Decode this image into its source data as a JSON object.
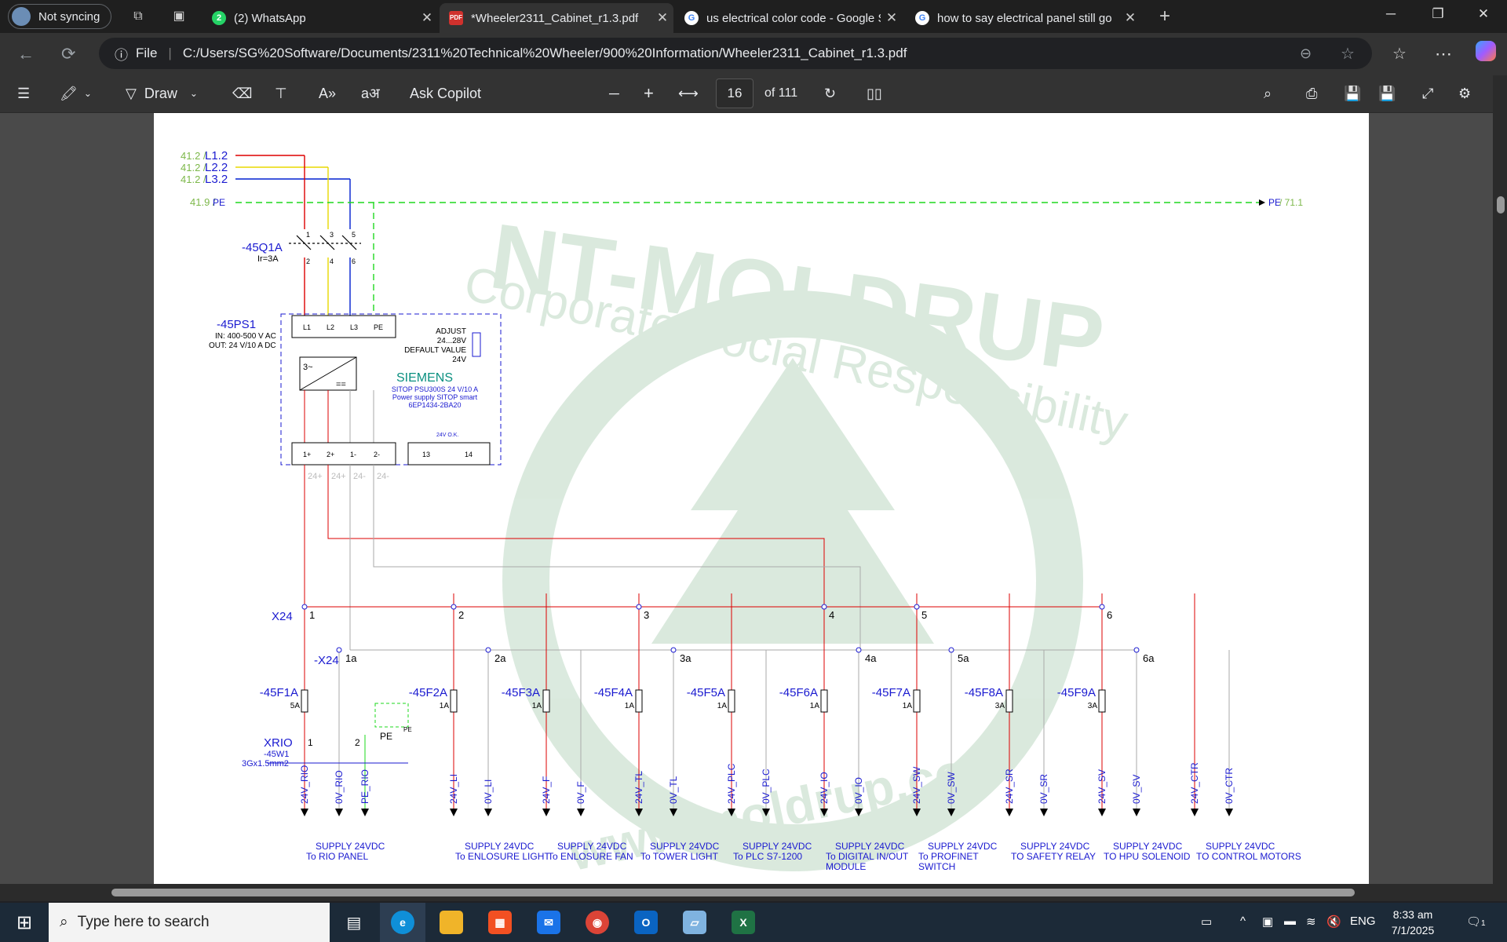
{
  "browser": {
    "profile_label": "Not syncing",
    "tabs": [
      {
        "title": "(2) WhatsApp",
        "badge": "2"
      },
      {
        "title": "*Wheeler2311_Cabinet_r1.3.pdf"
      },
      {
        "title": "us electrical color code - Google S"
      },
      {
        "title": "how to say electrical panel still go"
      }
    ],
    "address": {
      "scheme": "File",
      "url": "C:/Users/SG%20Software/Documents/2311%20Technical%20Wheeler/900%20Information/Wheeler2311_Cabinet_r1.3.pdf"
    }
  },
  "pdf_toolbar": {
    "draw_label": "Draw",
    "copilot_label": "Ask Copilot",
    "read_aloud_icon": "A»",
    "translate_icon": "aअ",
    "page_current": "16",
    "page_total": "of 111"
  },
  "taskbar": {
    "search_placeholder": "Type here to search",
    "time": "8:33 am",
    "date": "7/1/2025",
    "language": "ENG",
    "notification_count": "1"
  },
  "schematic": {
    "watermark_brand": "NT-MOLDRUP",
    "watermark_slogan": "Corporate Social Responsibility",
    "watermark_url": "www.moldrup.com",
    "inputs": [
      {
        "ref": "41.2 /",
        "label": "L1.2"
      },
      {
        "ref": "41.2 /",
        "label": "L2.2"
      },
      {
        "ref": "41.2 /",
        "label": "L3.2"
      },
      {
        "ref": "41.9 /",
        "label": "PE"
      }
    ],
    "pe_out": "PE",
    "pe_out_ref": "/ 71.1",
    "breaker": {
      "tag": "-45Q1A",
      "rating": "Ir=3A",
      "poles": [
        "1",
        "3",
        "5",
        "2",
        "4",
        "6"
      ]
    },
    "psu": {
      "tag": "-45PS1",
      "in": "IN: 400-500 V AC",
      "out": "OUT: 24 V/10 A DC",
      "adjust": [
        "ADJUST",
        "24...28V",
        "DEFAULT VALUE",
        "24V"
      ],
      "brand": "SIEMENS",
      "desc": [
        "SITOP PSU300S 24 V/10 A",
        "Power supply SITOP smart",
        "6EP1434-2BA20"
      ],
      "in_terms": [
        "L1",
        "L2",
        "L3",
        "PE"
      ],
      "out_terms": [
        "1+",
        "2+",
        "1-",
        "2-"
      ],
      "relay_terms": [
        "13",
        "14"
      ],
      "relay_label": "24V O.K.",
      "bus_labels": [
        "24+",
        "24+",
        "24-",
        "24-"
      ]
    },
    "terminal_x24": {
      "tag": "X24",
      "tag_minus": "-X24"
    },
    "terminal_xrio": {
      "tag": "XRIO",
      "cable": "-45W1",
      "cable_spec": "3Gx1.5mm2",
      "terms": [
        "1",
        "2",
        "PE"
      ]
    },
    "pe_small": "PE",
    "groups": [
      {
        "pos": "1",
        "neg": "1a",
        "fuse": "-45F1A",
        "rating": "5A",
        "l1": "24V_RIO",
        "l2": "0V_RIO",
        "l3": "PE_RIO",
        "d1": "SUPPLY 24VDC",
        "d2": "To RIO PANEL",
        "d3": ""
      },
      {
        "pos": "2",
        "neg": "2a",
        "fuse": "-45F2A",
        "rating": "1A",
        "l1": "24V_LI",
        "l2": "0V_LI",
        "d1": "SUPPLY 24VDC",
        "d2": "To ENLOSURE LIGHT",
        "d3": ""
      },
      {
        "fuse": "-45F3A",
        "rating": "1A",
        "l1": "24V_F",
        "l2": "0V_F",
        "d1": "SUPPLY 24VDC",
        "d2": "To ENLOSURE FAN",
        "d3": ""
      },
      {
        "pos": "3",
        "neg": "3a",
        "fuse": "-45F4A",
        "rating": "1A",
        "l1": "24V_TL",
        "l2": "0V_TL",
        "d1": "SUPPLY 24VDC",
        "d2": "To TOWER LIGHT",
        "d3": ""
      },
      {
        "fuse": "-45F5A",
        "rating": "1A",
        "l1": "24V_PLC",
        "l2": "0V_PLC",
        "d1": "SUPPLY 24VDC",
        "d2": "To PLC S7-1200",
        "d3": ""
      },
      {
        "pos": "4",
        "neg": "4a",
        "fuse": "-45F6A",
        "rating": "1A",
        "l1": "24V_IO",
        "l2": "0V_IO",
        "d1": "SUPPLY 24VDC",
        "d2": "To DIGITAL IN/OUT",
        "d3": "MODULE"
      },
      {
        "pos": "5",
        "neg": "5a",
        "fuse": "-45F7A",
        "rating": "1A",
        "l1": "24V_SW",
        "l2": "0V_SW",
        "d1": "SUPPLY 24VDC",
        "d2": "To PROFINET",
        "d3": "SWITCH"
      },
      {
        "fuse": "-45F8A",
        "rating": "3A",
        "l1": "24V_SR",
        "l2": "0V_SR",
        "d1": "SUPPLY 24VDC",
        "d2": "TO SAFETY RELAY",
        "d3": ""
      },
      {
        "pos": "6",
        "neg": "6a",
        "fuse": "-45F9A",
        "rating": "3A",
        "l1": "24V_SV",
        "l2": "0V_SV",
        "d1": "SUPPLY 24VDC",
        "d2": "TO HPU SOLENOID",
        "d3": ""
      },
      {
        "l1": "24V_CTR",
        "l2": "0V_CTR",
        "d1": "SUPPLY 24VDC",
        "d2": "TO CONTROL MOTORS",
        "d3": ""
      }
    ]
  }
}
